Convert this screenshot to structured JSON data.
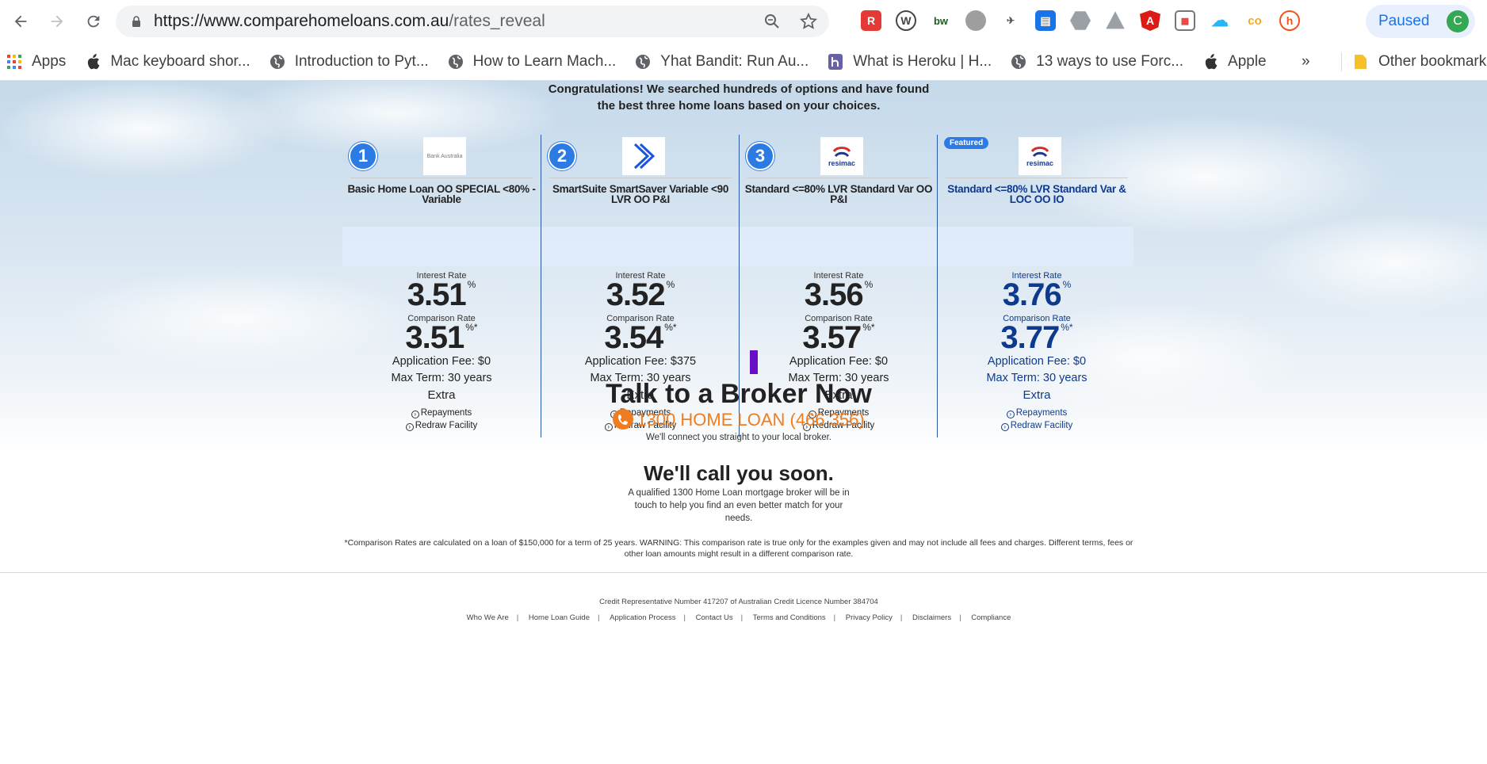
{
  "browser": {
    "url_domain": "https://www.comparehomeloans.com.au",
    "url_path": "/rates_reveal",
    "profile_label": "Paused",
    "profile_initial": "C",
    "bookmarks": [
      {
        "label": "Apps",
        "icon": "apps-grid-icon"
      },
      {
        "label": "Mac keyboard shor...",
        "icon": "apple-icon"
      },
      {
        "label": "Introduction to Pyt...",
        "icon": "globe-icon"
      },
      {
        "label": "How to Learn Mach...",
        "icon": "globe-icon"
      },
      {
        "label": "Yhat Bandit: Run Au...",
        "icon": "globe-icon"
      },
      {
        "label": "What is Heroku | H...",
        "icon": "heroku-icon"
      },
      {
        "label": "13 ways to use Forc...",
        "icon": "globe-icon"
      },
      {
        "label": "Apple",
        "icon": "apple-icon"
      }
    ],
    "more_label": "»",
    "other_bookmarks": "Other bookmarks"
  },
  "intro": {
    "line1": "Congratulations! We searched hundreds of options and have found",
    "line2": "the best three home loans based on your choices."
  },
  "cards": [
    {
      "rank": "1",
      "logo_text": "Bank Australia",
      "name": "Basic Home Loan OO SPECIAL <80% - Variable",
      "interest_label": "Interest Rate",
      "interest_rate": "3.51",
      "interest_unit": "%",
      "comparison_label": "Comparison Rate",
      "comparison_rate": "3.51",
      "comparison_unit": "%*",
      "application_fee": "Application Fee: $0",
      "max_term": "Max Term: 30 years",
      "extra_label": "Extra",
      "link1": "Repayments",
      "link2": "Redraw Facility"
    },
    {
      "rank": "2",
      "logo_text": "",
      "name": "SmartSuite SmartSaver Variable <90 LVR OO P&I",
      "interest_label": "Interest Rate",
      "interest_rate": "3.52",
      "interest_unit": "%",
      "comparison_label": "Comparison Rate",
      "comparison_rate": "3.54",
      "comparison_unit": "%*",
      "application_fee": "Application Fee: $375",
      "max_term": "Max Term: 30 years",
      "extra_label": "Extra",
      "link1": "Repayments",
      "link2": "Redraw Facility"
    },
    {
      "rank": "3",
      "logo_text": "resimac",
      "name": "Standard <=80% LVR Standard Var OO P&I",
      "interest_label": "Interest Rate",
      "interest_rate": "3.56",
      "interest_unit": "%",
      "comparison_label": "Comparison Rate",
      "comparison_rate": "3.57",
      "comparison_unit": "%*",
      "application_fee": "Application Fee: $0",
      "max_term": "Max Term: 30 years",
      "extra_label": "Extra",
      "link1": "Repayments",
      "link2": "Redraw Facility"
    },
    {
      "rank": "Featured",
      "logo_text": "resimac",
      "name": "Standard <=80% LVR Standard Var & LOC OO IO",
      "interest_label": "Interest Rate",
      "interest_rate": "3.76",
      "interest_unit": "%",
      "comparison_label": "Comparison Rate",
      "comparison_rate": "3.77",
      "comparison_unit": "%*",
      "application_fee": "Application Fee: $0",
      "max_term": "Max Term: 30 years",
      "extra_label": "Extra",
      "link1": "Repayments",
      "link2": "Redraw Facility"
    }
  ],
  "broker": {
    "title": "Talk to a Broker Now",
    "phone": "1300 HOME LOAN (466 356)",
    "connect": "We'll connect you straight to your local broker."
  },
  "call": {
    "title": "We'll call you soon.",
    "text": "A qualified 1300 Home Loan mortgage broker will be in touch to help you find an even better match for your needs."
  },
  "disclaimer": "*Comparison Rates are calculated on a loan of $150,000 for a term of 25 years. WARNING: This comparison rate is true only for the examples given and may not include all fees and charges. Different terms, fees or other loan amounts might result in a different comparison rate.",
  "footer": {
    "credit": "Credit Representative Number 417207 of Australian Credit Licence Number 384704",
    "links": [
      "Who We Are",
      "Home Loan Guide",
      "Application Process",
      "Contact Us",
      "Terms and Conditions",
      "Privacy Policy",
      "Disclaimers",
      "Compliance"
    ]
  },
  "colors": {
    "accent_blue": "#2c7be5",
    "featured_text": "#0d3a8c",
    "phone_orange": "#ef7d1f",
    "divider_blue": "#2a59a8"
  }
}
